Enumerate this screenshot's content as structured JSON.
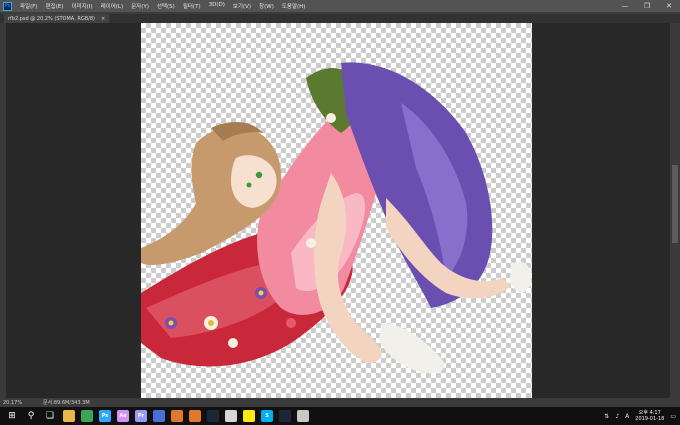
{
  "app": {
    "logo_text": "Ps"
  },
  "menu": [
    {
      "label": "파일(F)"
    },
    {
      "label": "편집(E)"
    },
    {
      "label": "이미지(I)"
    },
    {
      "label": "레이어(L)"
    },
    {
      "label": "문자(Y)"
    },
    {
      "label": "선택(S)"
    },
    {
      "label": "필터(T)"
    },
    {
      "label": "3D(D)"
    },
    {
      "label": "보기(V)"
    },
    {
      "label": "창(W)"
    },
    {
      "label": "도움말(H)"
    }
  ],
  "window_controls": {
    "minimize": "—",
    "maximize": "❐",
    "close": "✕"
  },
  "document_tab": {
    "title": "rfb2.psd @ 20.2% (STOMA, RGB/8)",
    "close": "×"
  },
  "status_bar": {
    "zoom": "20.17%",
    "doc_info": "문서:89.6M/343.3M"
  },
  "taskbar": {
    "apps": [
      {
        "name": "file-explorer",
        "label": "",
        "color": "#e8b84a"
      },
      {
        "name": "chrome",
        "label": "",
        "color": "#3aa757"
      },
      {
        "name": "photoshop",
        "label": "Ps",
        "color": "#31a8ff"
      },
      {
        "name": "after-effects",
        "label": "Ae",
        "color": "#d291ff"
      },
      {
        "name": "premiere",
        "label": "Pr",
        "color": "#9999ff"
      },
      {
        "name": "app-6",
        "label": "",
        "color": "#4b6fd6"
      },
      {
        "name": "app-7",
        "label": "",
        "color": "#e07a2a"
      },
      {
        "name": "app-8",
        "label": "",
        "color": "#e07a2a"
      },
      {
        "name": "steam",
        "label": "",
        "color": "#1b2838"
      },
      {
        "name": "app-10",
        "label": "",
        "color": "#d8d8d8"
      },
      {
        "name": "kakaotalk",
        "label": "",
        "color": "#ffe812"
      },
      {
        "name": "skype",
        "label": "S",
        "color": "#00aff0"
      },
      {
        "name": "steam-2",
        "label": "",
        "color": "#1b2838"
      },
      {
        "name": "app-14",
        "label": "",
        "color": "#c8c8c8"
      }
    ],
    "tray": {
      "ime": "A",
      "time": "오후 4:17",
      "date": "2019-01-18"
    }
  }
}
